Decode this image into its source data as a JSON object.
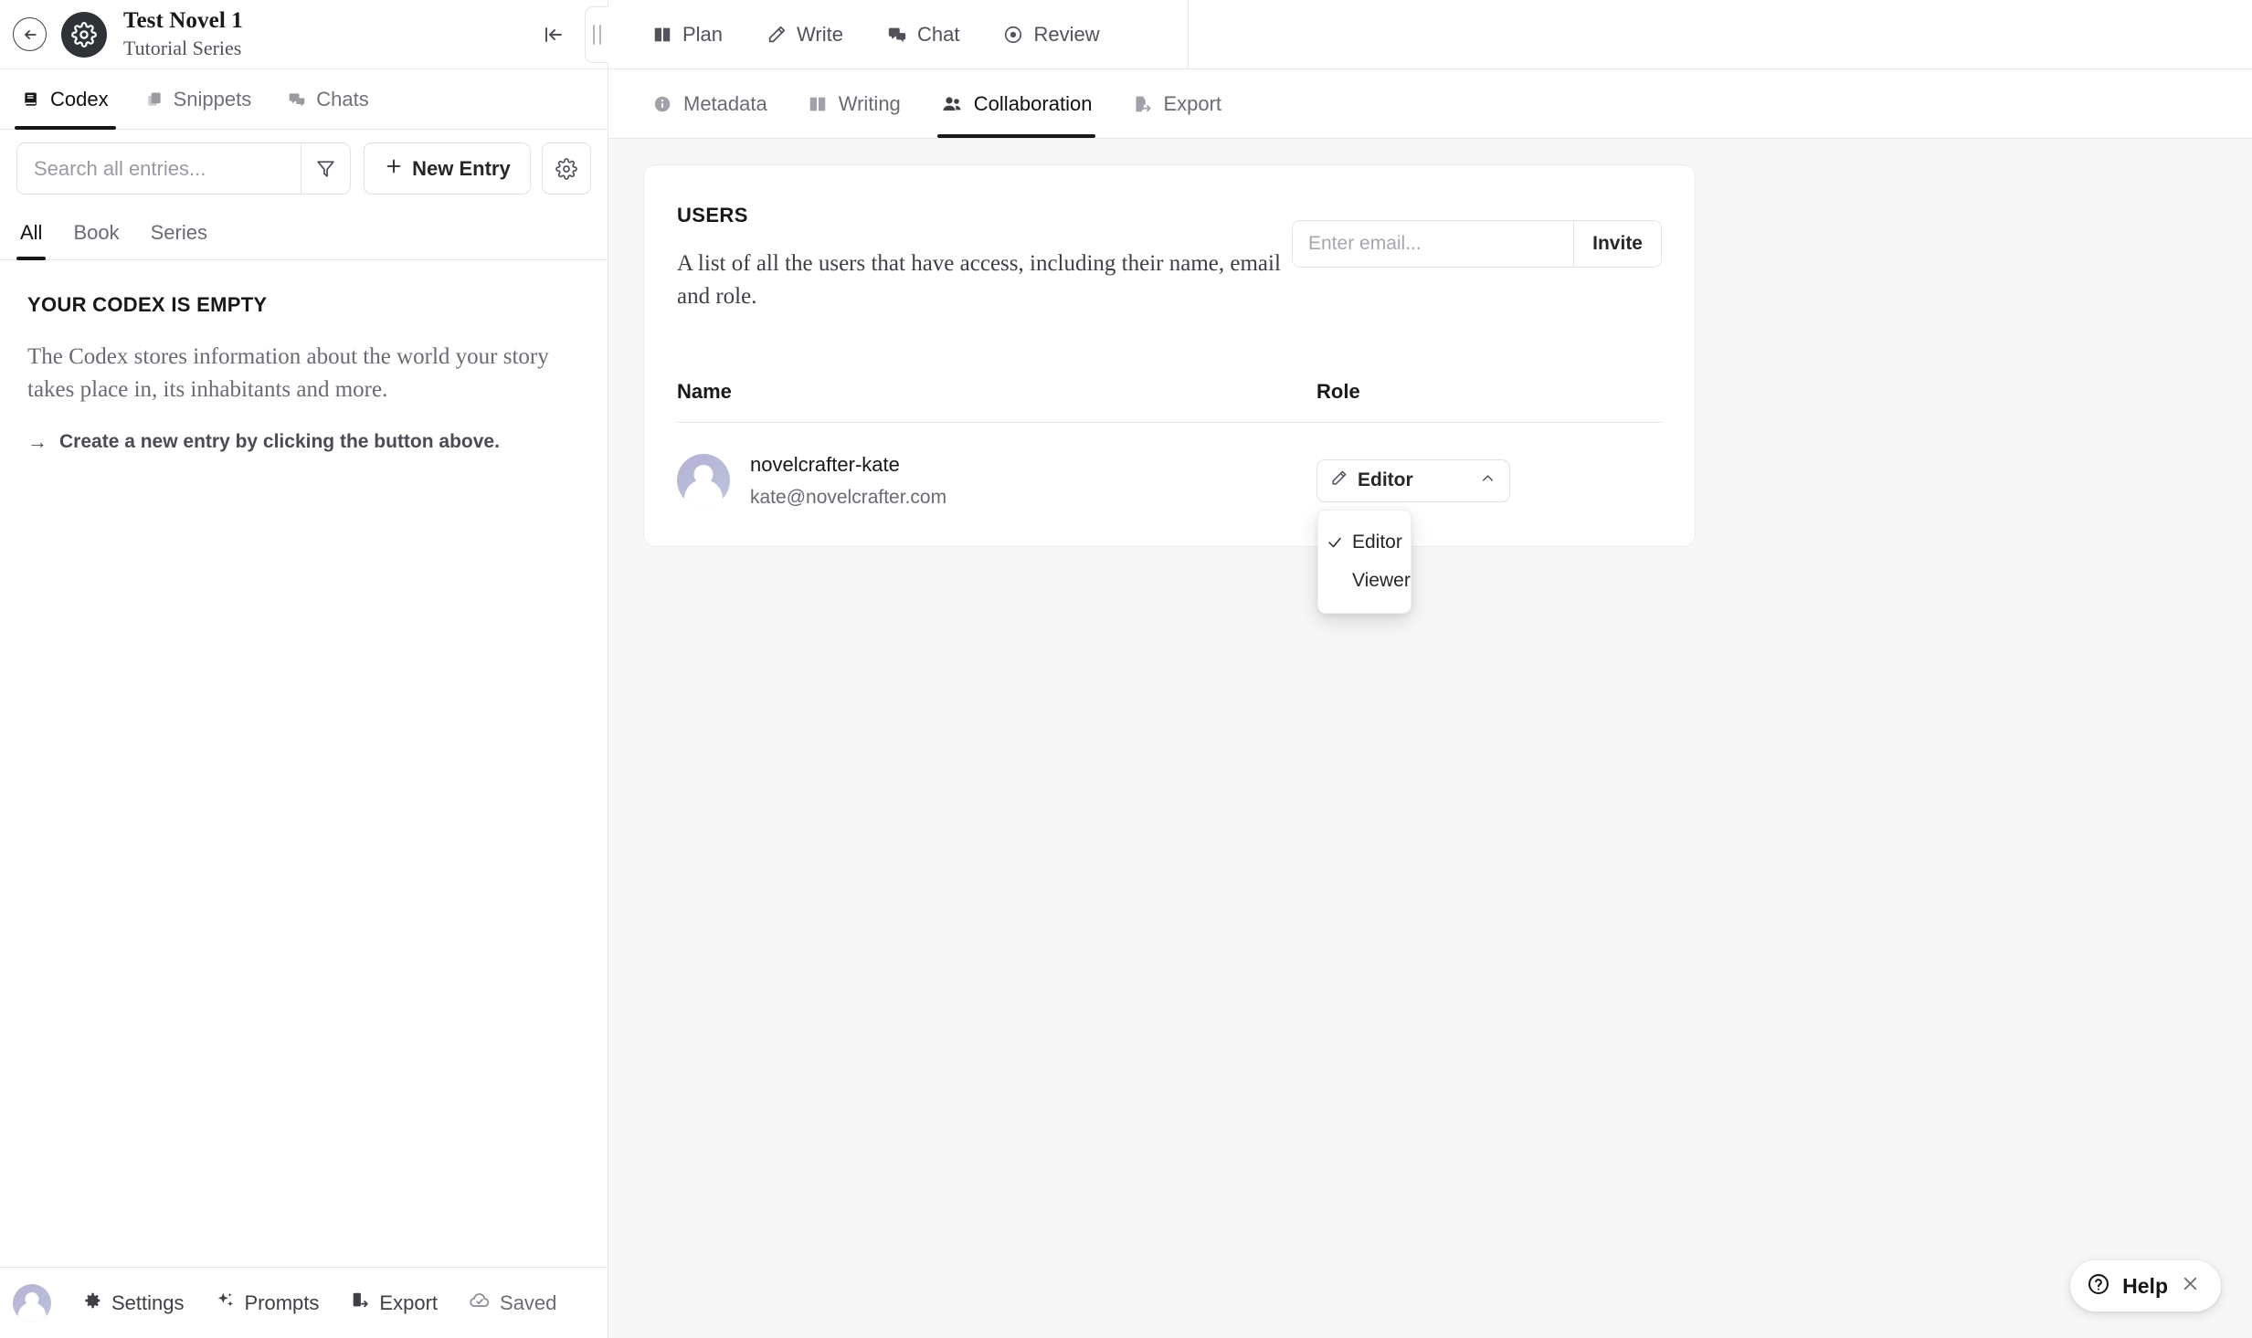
{
  "project": {
    "name": "Test Novel 1",
    "series": "Tutorial Series",
    "back_icon": "back-arrow-icon",
    "logo_icon": "gear-icon",
    "collapse_icon": "collapse-panel-icon",
    "resize_handle_icon": "drag-handle-icon"
  },
  "left_tabs": [
    {
      "label": "Codex",
      "icon": "book-closed-icon",
      "active": true
    },
    {
      "label": "Snippets",
      "icon": "copy-icon",
      "active": false
    },
    {
      "label": "Chats",
      "icon": "chat-bubbles-icon",
      "active": false
    }
  ],
  "search": {
    "placeholder": "Search all entries...",
    "value": "",
    "filter_icon": "funnel-filter-icon",
    "new_entry_label": "New Entry",
    "new_entry_icon": "plus-icon",
    "settings_icon": "gear-icon"
  },
  "filter_tabs": [
    {
      "label": "All",
      "active": true
    },
    {
      "label": "Book",
      "active": false
    },
    {
      "label": "Series",
      "active": false
    }
  ],
  "empty_state": {
    "title": "YOUR CODEX IS EMPTY",
    "description": "The Codex stores information about the world your story takes place in, its inhabitants and more.",
    "hint_arrow": "→",
    "hint": "Create a new entry by clicking the button above."
  },
  "top_nav": [
    {
      "label": "Plan",
      "icon": "open-book-icon"
    },
    {
      "label": "Write",
      "icon": "pencil-icon"
    },
    {
      "label": "Chat",
      "icon": "chat-bubbles-icon"
    },
    {
      "label": "Review",
      "icon": "eye-target-icon"
    }
  ],
  "sub_nav": [
    {
      "label": "Metadata",
      "icon": "info-circle-icon",
      "active": false
    },
    {
      "label": "Writing",
      "icon": "open-book-icon",
      "active": false
    },
    {
      "label": "Collaboration",
      "icon": "users-icon",
      "active": true
    },
    {
      "label": "Export",
      "icon": "file-export-icon",
      "active": false
    }
  ],
  "users_card": {
    "title": "USERS",
    "description": "A list of all the users that have access, including their name, email and role.",
    "invite": {
      "placeholder": "Enter email...",
      "value": "",
      "button_label": "Invite"
    },
    "columns": {
      "name": "Name",
      "role": "Role"
    },
    "rows": [
      {
        "avatar_icon": "user-avatar",
        "name": "novelcrafter-kate",
        "email": "kate@novelcrafter.com",
        "role": "Editor",
        "role_icon": "pencil-icon",
        "chevron_icon": "chevron-up-icon"
      }
    ],
    "role_menu": {
      "open": true,
      "options": [
        {
          "label": "Editor",
          "selected": true,
          "check_icon": "check-icon"
        },
        {
          "label": "Viewer",
          "selected": false,
          "check_icon": ""
        }
      ]
    }
  },
  "bottom_bar": {
    "avatar_icon": "user-avatar",
    "items": [
      {
        "label": "Settings",
        "icon": "gear-icon"
      },
      {
        "label": "Prompts",
        "icon": "sparkles-icon"
      },
      {
        "label": "Export",
        "icon": "file-export-icon"
      },
      {
        "label": "Saved",
        "icon": "cloud-check-icon"
      }
    ]
  },
  "help_widget": {
    "label": "Help",
    "help_icon": "question-circle-icon",
    "close_icon": "close-x-icon"
  },
  "colors": {
    "accent": "#18181b",
    "panel_bg": "#f7f7f8",
    "border": "#e6e6e6",
    "muted_text": "#6b6b73",
    "avatar_gradient_from": "#b6b2d6",
    "avatar_gradient_to": "#c3c6dd"
  }
}
